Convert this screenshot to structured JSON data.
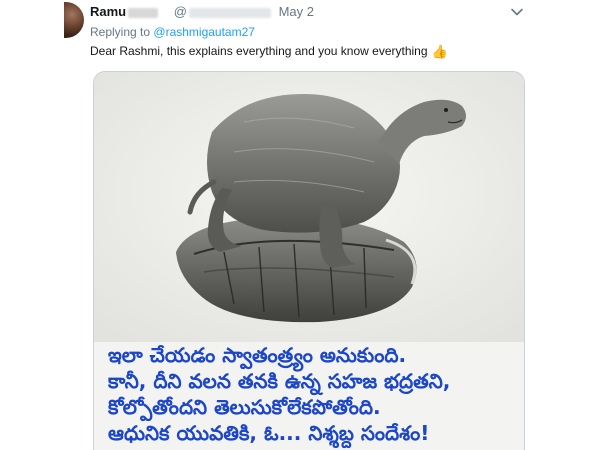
{
  "tweet": {
    "author_name": "Ramu",
    "handle_prefix": "@",
    "date": "May 2",
    "reply_prefix": "Replying to",
    "reply_handle": "@rashmigautam27",
    "text": "Dear Rashmi, this explains everything and you know everything",
    "emoji": "👍"
  },
  "media": {
    "caption_lines": [
      "ఇలా చేయడం స్వాతంత్ర్యం అనుకుంది.",
      "కానీ, దీని వలన తనకి ఉన్న సహజ భద్రతని,",
      "కోల్పోతోందని తెలుసుకోలేకపోతోంది.",
      "ఆధునిక యువతికి,  ఓ...  నిశ్శబ్ద సందేశం!"
    ]
  },
  "colors": {
    "link": "#1da1f2",
    "caption": "#1c46c8",
    "muted": "#657786"
  },
  "icons": [
    "chevron-down-icon",
    "thumbs-up-icon"
  ]
}
